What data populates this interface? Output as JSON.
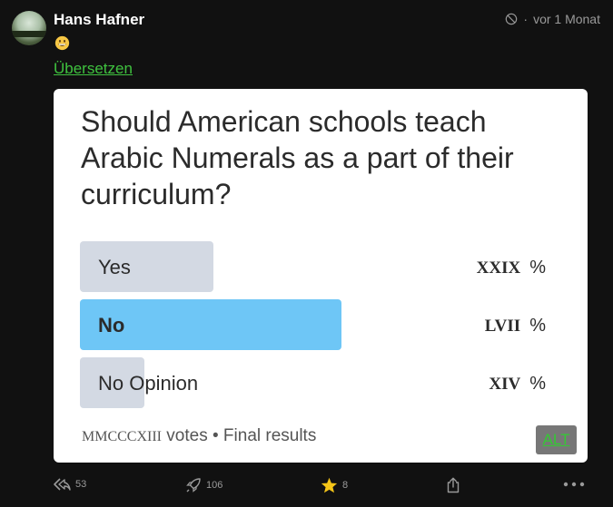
{
  "post": {
    "author": "Hans Hafner",
    "timestamp": "vor 1 Monat",
    "translate_link": "Übersetzen"
  },
  "poll": {
    "question": "Should American schools teach Arabic Numerals as a part of their curriculum?",
    "options": [
      {
        "label": "Yes",
        "percent_roman": "XXIX",
        "percent_sign": "%",
        "share": 0.29,
        "highlighted": false
      },
      {
        "label": "No",
        "percent_roman": "LVII",
        "percent_sign": "%",
        "share": 0.57,
        "highlighted": true
      },
      {
        "label": "No Opinion",
        "percent_roman": "XIV",
        "percent_sign": "%",
        "share": 0.14,
        "highlighted": false
      }
    ],
    "votes_roman": "MMCCCXIII",
    "votes_suffix": "votes • Final results"
  },
  "alt_label": "ALT",
  "actions": {
    "reply_count": "53",
    "boost_count": "106",
    "favourite_count": "8"
  },
  "colors": {
    "bar_default": "#d3d9e3",
    "bar_selected": "#6ec6f6",
    "link_green": "#3fc23f",
    "star": "#f5c518"
  }
}
